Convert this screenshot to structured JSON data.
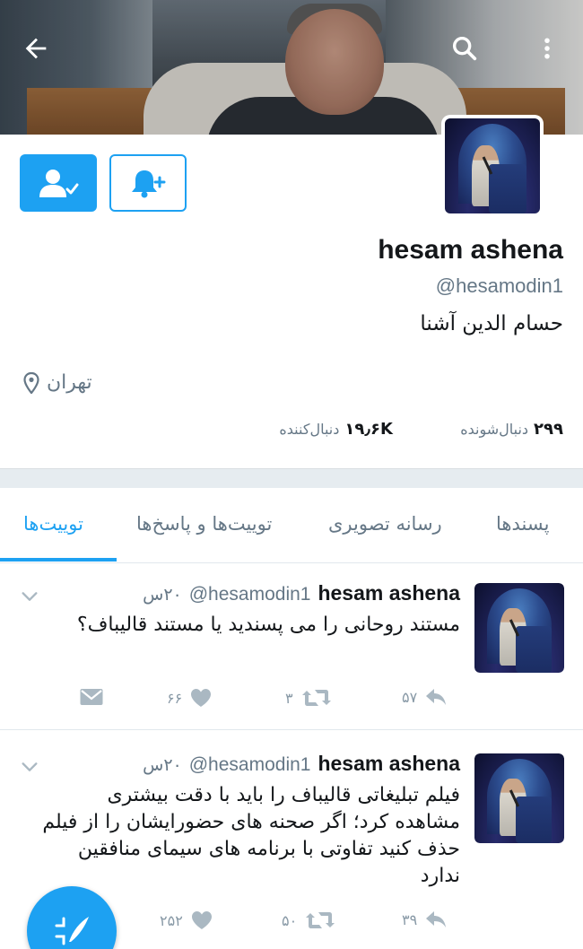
{
  "header": {
    "back_icon": "arrow-left-icon",
    "search_icon": "search-icon",
    "more_icon": "more-vertical-icon"
  },
  "profile": {
    "name": "hesam ashena",
    "handle": "@hesamodin1",
    "bio": "حسام الدین آشنا",
    "location": "تهران",
    "following_count": "۲۹۹",
    "following_label": "دنبال‌شونده",
    "followers_count": "۱۹٫۶K",
    "followers_label": "دنبال‌کننده",
    "follow_icon": "user-check-icon",
    "notify_icon": "bell-plus-icon"
  },
  "colors": {
    "accent": "#1da1f2",
    "muted": "#657786",
    "band": "#e6ecf0"
  },
  "tabs": [
    {
      "label": "توییت‌ها",
      "active": true
    },
    {
      "label": "توییت‌ها و پاسخ‌ها",
      "active": false
    },
    {
      "label": "رسانه تصویری",
      "active": false
    },
    {
      "label": "پسندها",
      "active": false
    }
  ],
  "tweets": [
    {
      "name": "hesam ashena",
      "handle": "@hesamodin1",
      "time": "۲۰س",
      "text": "مستند روحانی را می پسندید یا مستند قالیباف؟",
      "replies": "۵۷",
      "retweets": "۳",
      "likes": "۶۶"
    },
    {
      "name": "hesam ashena",
      "handle": "@hesamodin1",
      "time": "۲۰س",
      "text": "فیلم تبلیغاتی قالیباف را باید با دقت بیشتری مشاهده کرد؛ اگر صحنه های حضورایشان را از فیلم حذف کنید تفاوتی با برنامه های سیمای منافقین ندارد",
      "replies": "۳۹",
      "retweets": "۵۰",
      "likes": "۲۵۲"
    }
  ],
  "fab": {
    "icon": "compose-tweet-icon"
  }
}
